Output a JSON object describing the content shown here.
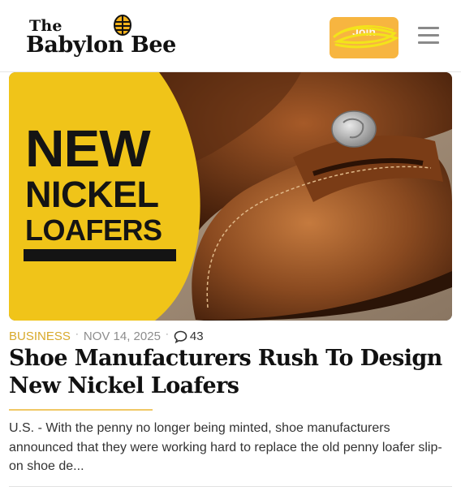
{
  "header": {
    "logo_the": "The",
    "logo_name": "Babylon Bee",
    "join_label": "Join",
    "bee_icon": "bee-icon",
    "menu_icon": "hamburger-menu-icon"
  },
  "hero": {
    "line1": "NEW",
    "line2": "NICKEL",
    "line3": "LOAFERS"
  },
  "article": {
    "category": "BUSINESS",
    "date": "NOV 14, 2025",
    "comment_count": "43",
    "headline": "Shoe Manufacturers Rush To Design New Nickel Loafers",
    "excerpt": "U.S. - With the penny no longer being minted, shoe manufacturers announced that they were working hard to replace the old penny loafer slip-on shoe de..."
  },
  "colors": {
    "accent_gold": "#f7b540",
    "category_gold": "#d8a92a",
    "hero_yellow": "#f0c419",
    "text_dark": "#111111"
  }
}
